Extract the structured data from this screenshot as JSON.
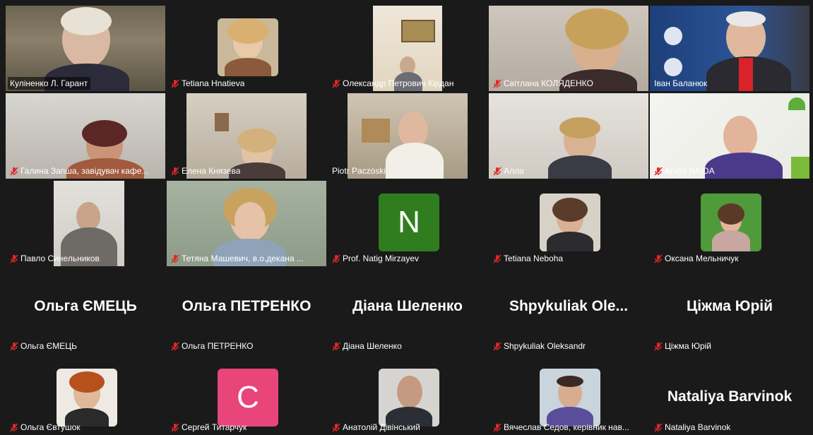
{
  "participants": [
    {
      "name": "Куліненко Л. Гарант",
      "muted": false
    },
    {
      "name": "Tetiana Hnatieva",
      "muted": true
    },
    {
      "name": "Олександр Петрович Кірдан",
      "muted": true
    },
    {
      "name": "Світлана КОЛЯДЕНКО",
      "muted": true
    },
    {
      "name": "Іван Баланюк",
      "muted": false
    },
    {
      "name": "Галина Запша, завідувач кафе...",
      "muted": true
    },
    {
      "name": "Елена Князева",
      "muted": true
    },
    {
      "name": "Piotr Paczóski",
      "muted": false
    },
    {
      "name": "Алла",
      "muted": true
    },
    {
      "name": "Andrii NAIDA",
      "muted": true
    },
    {
      "name": "Павло Синельников",
      "muted": true
    },
    {
      "name": "Тетяна Машевич, в.о.декана ...",
      "muted": true
    },
    {
      "name": "Prof. Natig Mirzayev",
      "muted": true,
      "initial": "N"
    },
    {
      "name": "Tetiana Neboha",
      "muted": true
    },
    {
      "name": "Оксана Мельничук",
      "muted": true
    },
    {
      "name": "Ольга ЄМЕЦЬ",
      "muted": true,
      "display": "Ольга ЄМЕЦЬ"
    },
    {
      "name": "Ольга ПЕТРЕНКО",
      "muted": true,
      "display": "Ольга ПЕТРЕНКО"
    },
    {
      "name": "Діана Шеленко",
      "muted": true,
      "display": "Діана Шеленко"
    },
    {
      "name": "Shpykuliak Oleksandr",
      "muted": true,
      "display": "Shpykuliak  Ole..."
    },
    {
      "name": "Ціжма Юрій",
      "muted": true,
      "display": "Ціжма Юрій"
    },
    {
      "name": "Ольга Євтушок",
      "muted": true
    },
    {
      "name": "Сергей Титарчук",
      "muted": true,
      "initial": "C"
    },
    {
      "name": "Анатолій Дівінський",
      "muted": true
    },
    {
      "name": "Вячеслав Седов, керівник нав...",
      "muted": true
    },
    {
      "name": "Nataliya Barvinok",
      "muted": true,
      "display": "Nataliya Barvinok"
    }
  ],
  "colors": {
    "background": "#1a1a1a",
    "active_speaker_border": "#23d959",
    "mute_icon": "#e02828",
    "avatar_green": "#2f7d1f",
    "avatar_pink": "#e8457a"
  }
}
